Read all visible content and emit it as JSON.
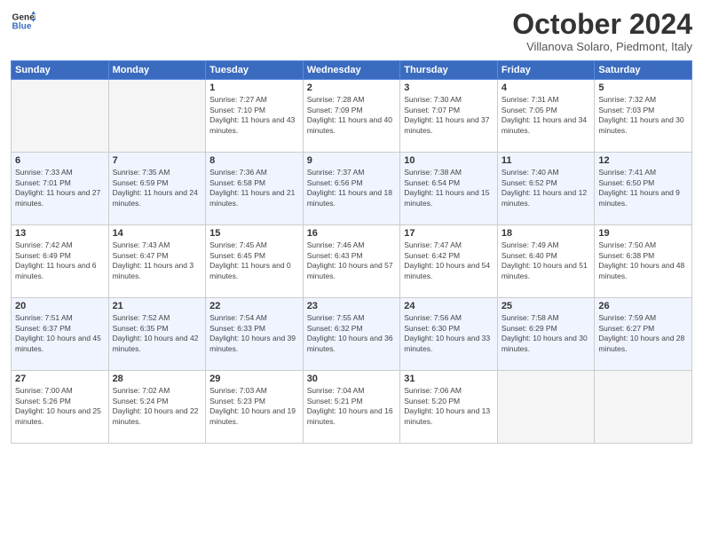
{
  "header": {
    "logo_line1": "General",
    "logo_line2": "Blue",
    "month": "October 2024",
    "location": "Villanova Solaro, Piedmont, Italy"
  },
  "weekdays": [
    "Sunday",
    "Monday",
    "Tuesday",
    "Wednesday",
    "Thursday",
    "Friday",
    "Saturday"
  ],
  "weeks": [
    [
      {
        "day": "",
        "sunrise": "",
        "sunset": "",
        "daylight": ""
      },
      {
        "day": "",
        "sunrise": "",
        "sunset": "",
        "daylight": ""
      },
      {
        "day": "1",
        "sunrise": "Sunrise: 7:27 AM",
        "sunset": "Sunset: 7:10 PM",
        "daylight": "Daylight: 11 hours and 43 minutes."
      },
      {
        "day": "2",
        "sunrise": "Sunrise: 7:28 AM",
        "sunset": "Sunset: 7:09 PM",
        "daylight": "Daylight: 11 hours and 40 minutes."
      },
      {
        "day": "3",
        "sunrise": "Sunrise: 7:30 AM",
        "sunset": "Sunset: 7:07 PM",
        "daylight": "Daylight: 11 hours and 37 minutes."
      },
      {
        "day": "4",
        "sunrise": "Sunrise: 7:31 AM",
        "sunset": "Sunset: 7:05 PM",
        "daylight": "Daylight: 11 hours and 34 minutes."
      },
      {
        "day": "5",
        "sunrise": "Sunrise: 7:32 AM",
        "sunset": "Sunset: 7:03 PM",
        "daylight": "Daylight: 11 hours and 30 minutes."
      }
    ],
    [
      {
        "day": "6",
        "sunrise": "Sunrise: 7:33 AM",
        "sunset": "Sunset: 7:01 PM",
        "daylight": "Daylight: 11 hours and 27 minutes."
      },
      {
        "day": "7",
        "sunrise": "Sunrise: 7:35 AM",
        "sunset": "Sunset: 6:59 PM",
        "daylight": "Daylight: 11 hours and 24 minutes."
      },
      {
        "day": "8",
        "sunrise": "Sunrise: 7:36 AM",
        "sunset": "Sunset: 6:58 PM",
        "daylight": "Daylight: 11 hours and 21 minutes."
      },
      {
        "day": "9",
        "sunrise": "Sunrise: 7:37 AM",
        "sunset": "Sunset: 6:56 PM",
        "daylight": "Daylight: 11 hours and 18 minutes."
      },
      {
        "day": "10",
        "sunrise": "Sunrise: 7:38 AM",
        "sunset": "Sunset: 6:54 PM",
        "daylight": "Daylight: 11 hours and 15 minutes."
      },
      {
        "day": "11",
        "sunrise": "Sunrise: 7:40 AM",
        "sunset": "Sunset: 6:52 PM",
        "daylight": "Daylight: 11 hours and 12 minutes."
      },
      {
        "day": "12",
        "sunrise": "Sunrise: 7:41 AM",
        "sunset": "Sunset: 6:50 PM",
        "daylight": "Daylight: 11 hours and 9 minutes."
      }
    ],
    [
      {
        "day": "13",
        "sunrise": "Sunrise: 7:42 AM",
        "sunset": "Sunset: 6:49 PM",
        "daylight": "Daylight: 11 hours and 6 minutes."
      },
      {
        "day": "14",
        "sunrise": "Sunrise: 7:43 AM",
        "sunset": "Sunset: 6:47 PM",
        "daylight": "Daylight: 11 hours and 3 minutes."
      },
      {
        "day": "15",
        "sunrise": "Sunrise: 7:45 AM",
        "sunset": "Sunset: 6:45 PM",
        "daylight": "Daylight: 11 hours and 0 minutes."
      },
      {
        "day": "16",
        "sunrise": "Sunrise: 7:46 AM",
        "sunset": "Sunset: 6:43 PM",
        "daylight": "Daylight: 10 hours and 57 minutes."
      },
      {
        "day": "17",
        "sunrise": "Sunrise: 7:47 AM",
        "sunset": "Sunset: 6:42 PM",
        "daylight": "Daylight: 10 hours and 54 minutes."
      },
      {
        "day": "18",
        "sunrise": "Sunrise: 7:49 AM",
        "sunset": "Sunset: 6:40 PM",
        "daylight": "Daylight: 10 hours and 51 minutes."
      },
      {
        "day": "19",
        "sunrise": "Sunrise: 7:50 AM",
        "sunset": "Sunset: 6:38 PM",
        "daylight": "Daylight: 10 hours and 48 minutes."
      }
    ],
    [
      {
        "day": "20",
        "sunrise": "Sunrise: 7:51 AM",
        "sunset": "Sunset: 6:37 PM",
        "daylight": "Daylight: 10 hours and 45 minutes."
      },
      {
        "day": "21",
        "sunrise": "Sunrise: 7:52 AM",
        "sunset": "Sunset: 6:35 PM",
        "daylight": "Daylight: 10 hours and 42 minutes."
      },
      {
        "day": "22",
        "sunrise": "Sunrise: 7:54 AM",
        "sunset": "Sunset: 6:33 PM",
        "daylight": "Daylight: 10 hours and 39 minutes."
      },
      {
        "day": "23",
        "sunrise": "Sunrise: 7:55 AM",
        "sunset": "Sunset: 6:32 PM",
        "daylight": "Daylight: 10 hours and 36 minutes."
      },
      {
        "day": "24",
        "sunrise": "Sunrise: 7:56 AM",
        "sunset": "Sunset: 6:30 PM",
        "daylight": "Daylight: 10 hours and 33 minutes."
      },
      {
        "day": "25",
        "sunrise": "Sunrise: 7:58 AM",
        "sunset": "Sunset: 6:29 PM",
        "daylight": "Daylight: 10 hours and 30 minutes."
      },
      {
        "day": "26",
        "sunrise": "Sunrise: 7:59 AM",
        "sunset": "Sunset: 6:27 PM",
        "daylight": "Daylight: 10 hours and 28 minutes."
      }
    ],
    [
      {
        "day": "27",
        "sunrise": "Sunrise: 7:00 AM",
        "sunset": "Sunset: 5:26 PM",
        "daylight": "Daylight: 10 hours and 25 minutes."
      },
      {
        "day": "28",
        "sunrise": "Sunrise: 7:02 AM",
        "sunset": "Sunset: 5:24 PM",
        "daylight": "Daylight: 10 hours and 22 minutes."
      },
      {
        "day": "29",
        "sunrise": "Sunrise: 7:03 AM",
        "sunset": "Sunset: 5:23 PM",
        "daylight": "Daylight: 10 hours and 19 minutes."
      },
      {
        "day": "30",
        "sunrise": "Sunrise: 7:04 AM",
        "sunset": "Sunset: 5:21 PM",
        "daylight": "Daylight: 10 hours and 16 minutes."
      },
      {
        "day": "31",
        "sunrise": "Sunrise: 7:06 AM",
        "sunset": "Sunset: 5:20 PM",
        "daylight": "Daylight: 10 hours and 13 minutes."
      },
      {
        "day": "",
        "sunrise": "",
        "sunset": "",
        "daylight": ""
      },
      {
        "day": "",
        "sunrise": "",
        "sunset": "",
        "daylight": ""
      }
    ]
  ]
}
